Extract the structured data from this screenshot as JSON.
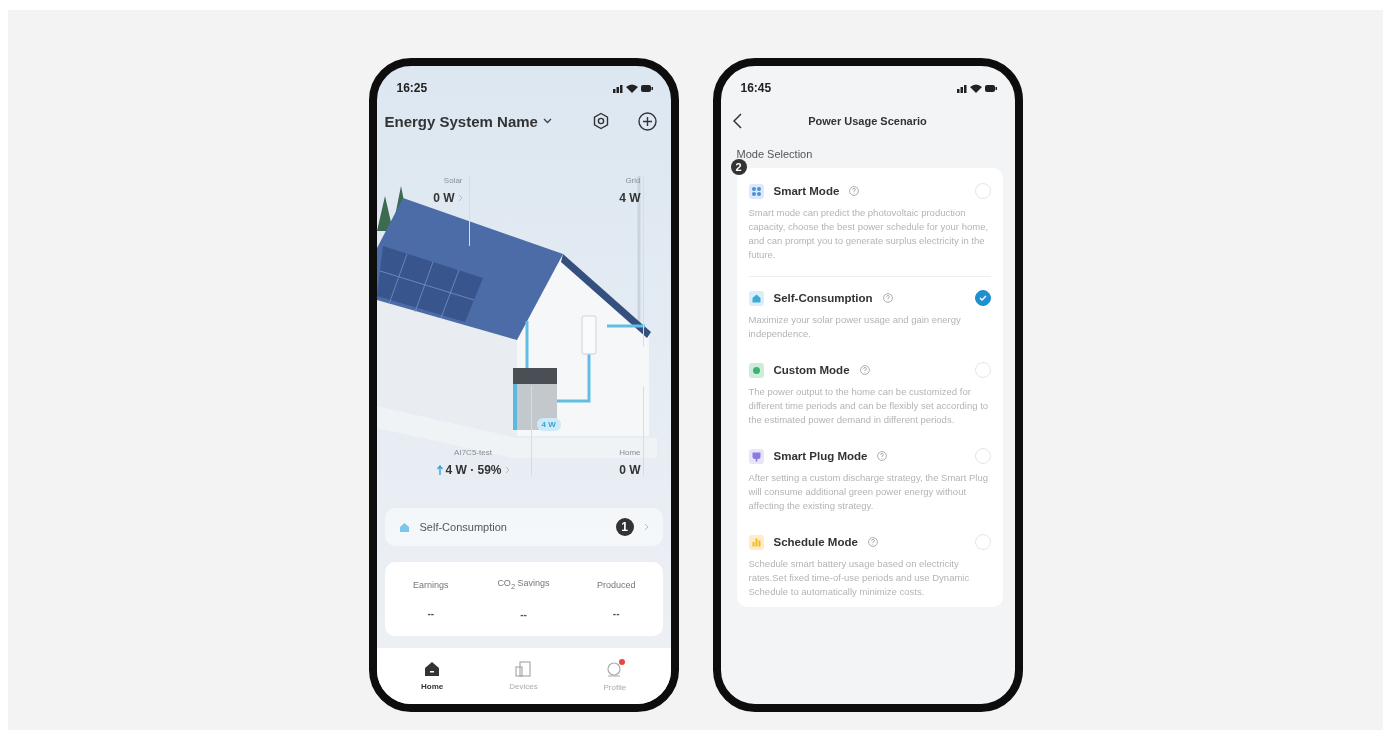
{
  "home_screen": {
    "status_time": "16:25",
    "system_name": "Energy System Name",
    "flows": [
      {
        "label": "Solar",
        "value": "0 W",
        "linked": true,
        "charging": false
      },
      {
        "label": "Grid",
        "value": "4 W",
        "linked": false,
        "charging": false
      },
      {
        "label": "AI7C5-test",
        "value": "4 W · 59%",
        "linked": true,
        "charging": true
      },
      {
        "label": "Home",
        "value": "0 W",
        "linked": false,
        "charging": false
      }
    ],
    "flow_badge": "4 W",
    "mode_bar": {
      "label": "Self-Consumption",
      "marker": "1"
    },
    "stats": [
      {
        "label": "Earnings",
        "value": "--"
      },
      {
        "label": "CO$_{2}$ Savings",
        "value": "--"
      },
      {
        "label": "Produced",
        "value": "--"
      }
    ],
    "nav": [
      {
        "label": "Home",
        "selected": true,
        "notification": false
      },
      {
        "label": "Devices",
        "selected": false,
        "notification": false
      },
      {
        "label": "Profile",
        "selected": false,
        "notification": true
      }
    ]
  },
  "scenario_screen": {
    "status_time": "16:45",
    "title": "Power Usage Scenario",
    "section": "Mode Selection",
    "marker": "2",
    "modes": [
      {
        "name": "Smart Mode",
        "color": "#4a8fe0",
        "selected": false,
        "description": "Smart mode can predict the photovoltaic production capacity, choose the best power schedule for your home, and can prompt you to generate surplus electricity in the future."
      },
      {
        "name": "Self-Consumption",
        "color": "#3fa9d6",
        "selected": true,
        "description": "Maximize your solar power usage and gain energy independence."
      },
      {
        "name": "Custom Mode",
        "color": "#3cb371",
        "selected": false,
        "description": "The power output to the home can be customized for different time periods and can be flexibly set according to the estimated power demand in different periods."
      },
      {
        "name": "Smart Plug Mode",
        "color": "#8a7be0",
        "selected": false,
        "description": "After setting a custom discharge strategy, the Smart Plug will consume additional green power energy without affecting the existing strategy."
      },
      {
        "name": "Schedule Mode",
        "color": "#f2b920",
        "selected": false,
        "description": "Schedule smart battery usage based on electricity rates.Set fixed time-of-use periods and use Dynamic Schedule to automatically minimize costs."
      }
    ]
  }
}
